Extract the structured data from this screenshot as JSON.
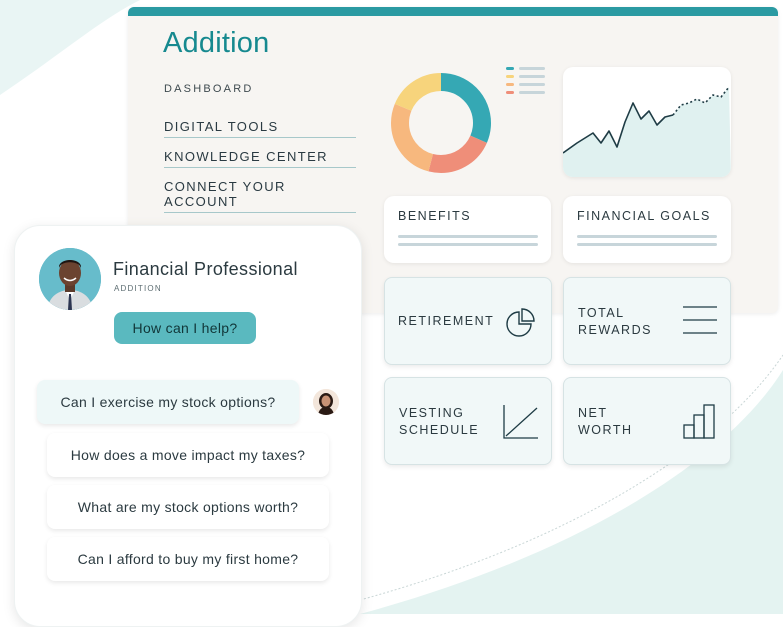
{
  "dashboard": {
    "logo": "Addition",
    "nav_heading": "DASHBOARD",
    "nav_items": [
      "DIGITAL TOOLS",
      "KNOWLEDGE CENTER",
      "CONNECT YOUR ACCOUNT"
    ],
    "cards": {
      "benefits": "BENEFITS",
      "financial_goals": "FINANCIAL GOALS",
      "retirement": "RETIREMENT",
      "total_rewards_line1": "TOTAL",
      "total_rewards_line2": "REWARDS",
      "vesting_line1": "VESTING",
      "vesting_line2": "SCHEDULE",
      "net_worth_line1": "NET",
      "net_worth_line2": "WORTH"
    }
  },
  "chat": {
    "professional_name": "Financial Professional",
    "professional_org": "ADDITION",
    "greeting": "How can I help?",
    "questions": [
      "Can I exercise my stock options?",
      "How does a move impact my taxes?",
      "What are my stock options worth?",
      "Can I afford to buy my first home?"
    ]
  },
  "colors": {
    "brand_teal": "#16898f",
    "accent_bar": "#2a9aa2",
    "bubble_teal": "#5ab9bf",
    "donut": [
      "#35a8b4",
      "#ef8e79",
      "#f7b87e",
      "#f7d47c"
    ]
  }
}
